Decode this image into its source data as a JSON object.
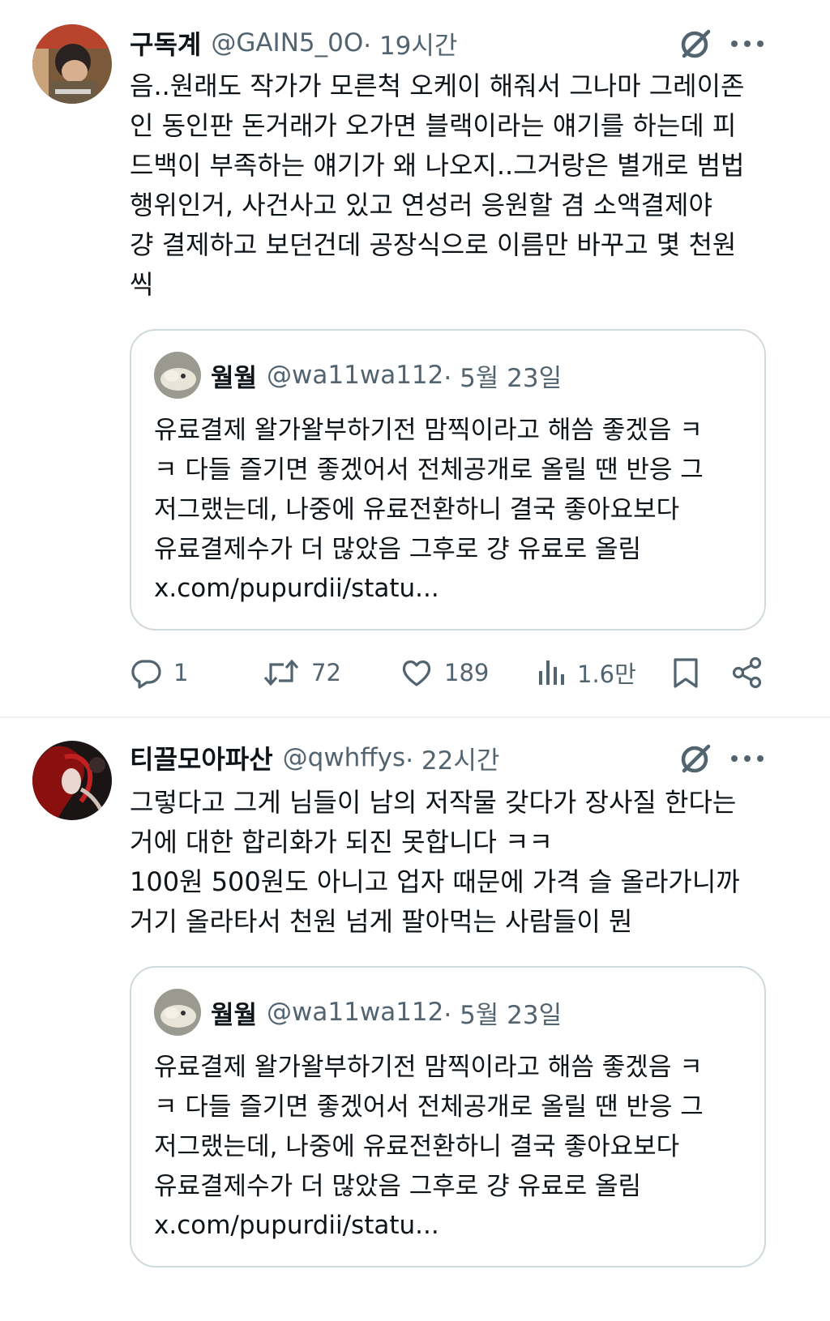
{
  "tweets": [
    {
      "name": "구독계",
      "handle": "@GAIN5_0O",
      "time": " · 19시간",
      "text": "음..원래도 작가가 모른척 오케이 해줘서 그나마 그레이존\n인 동인판 돈거래가 오가면 블랙이라는 얘기를 하는데 피\n드백이 부족하는 얘기가 왜 나오지..그거랑은 별개로 범법\n행위인거,  사건사고 있고 연성러 응원할 겸 소액결제야\n걍 결제하고 보던건데 공장식으로 이름만 바꾸고 몇 천원\n씩",
      "quote": {
        "name": "월월",
        "handle": "@wa11wa112",
        "time": " · 5월 23일",
        "text": "유료결제 왈가왈부하기전 맘찍이라고 해씀 좋겠음 ㅋ\nㅋ 다들 즐기면 좋겠어서 전체공개로 올릴 땐 반응 그\n저그랬는데, 나중에 유료전환하니 결국 좋아요보다\n유료결제수가 더 많았음 그후로 걍 유료로 올림",
        "link": "x.com/pupurdii/statu..."
      },
      "actions": {
        "reply": "1",
        "retweet": "72",
        "like": "189",
        "views": "1.6만"
      }
    },
    {
      "name": "티끌모아파산",
      "handle": "@qwhffys",
      "time": " · 22시간",
      "text": "그렇다고 그게 님들이 남의 저작물 갖다가 장사질 한다는\n거에 대한 합리화가 되진 못합니다 ㅋㅋ\n100원 500원도 아니고 업자 때문에 가격 슬 올라가니까\n거기 올라타서 천원 넘게 팔아먹는 사람들이 뭔",
      "quote": {
        "name": "월월",
        "handle": "@wa11wa112",
        "time": " · 5월 23일",
        "text": "유료결제 왈가왈부하기전 맘찍이라고 해씀 좋겠음 ㅋ\nㅋ 다들 즐기면 좋겠어서 전체공개로 올릴 땐 반응 그\n저그랬는데, 나중에 유료전환하니 결국 좋아요보다\n유료결제수가 더 많았음 그후로 걍 유료로 올림",
        "link": "x.com/pupurdii/statu..."
      }
    }
  ],
  "icons": {
    "grok": "grok-icon",
    "more": "more-icon",
    "reply": "reply-icon",
    "retweet": "retweet-icon",
    "like": "heart-icon",
    "views": "views-icon",
    "bookmark": "bookmark-icon",
    "share": "share-icon"
  },
  "colors": {
    "text": "#0f1419",
    "secondary": "#536471",
    "border": "#cfd9de",
    "divider": "#eff3f4"
  }
}
